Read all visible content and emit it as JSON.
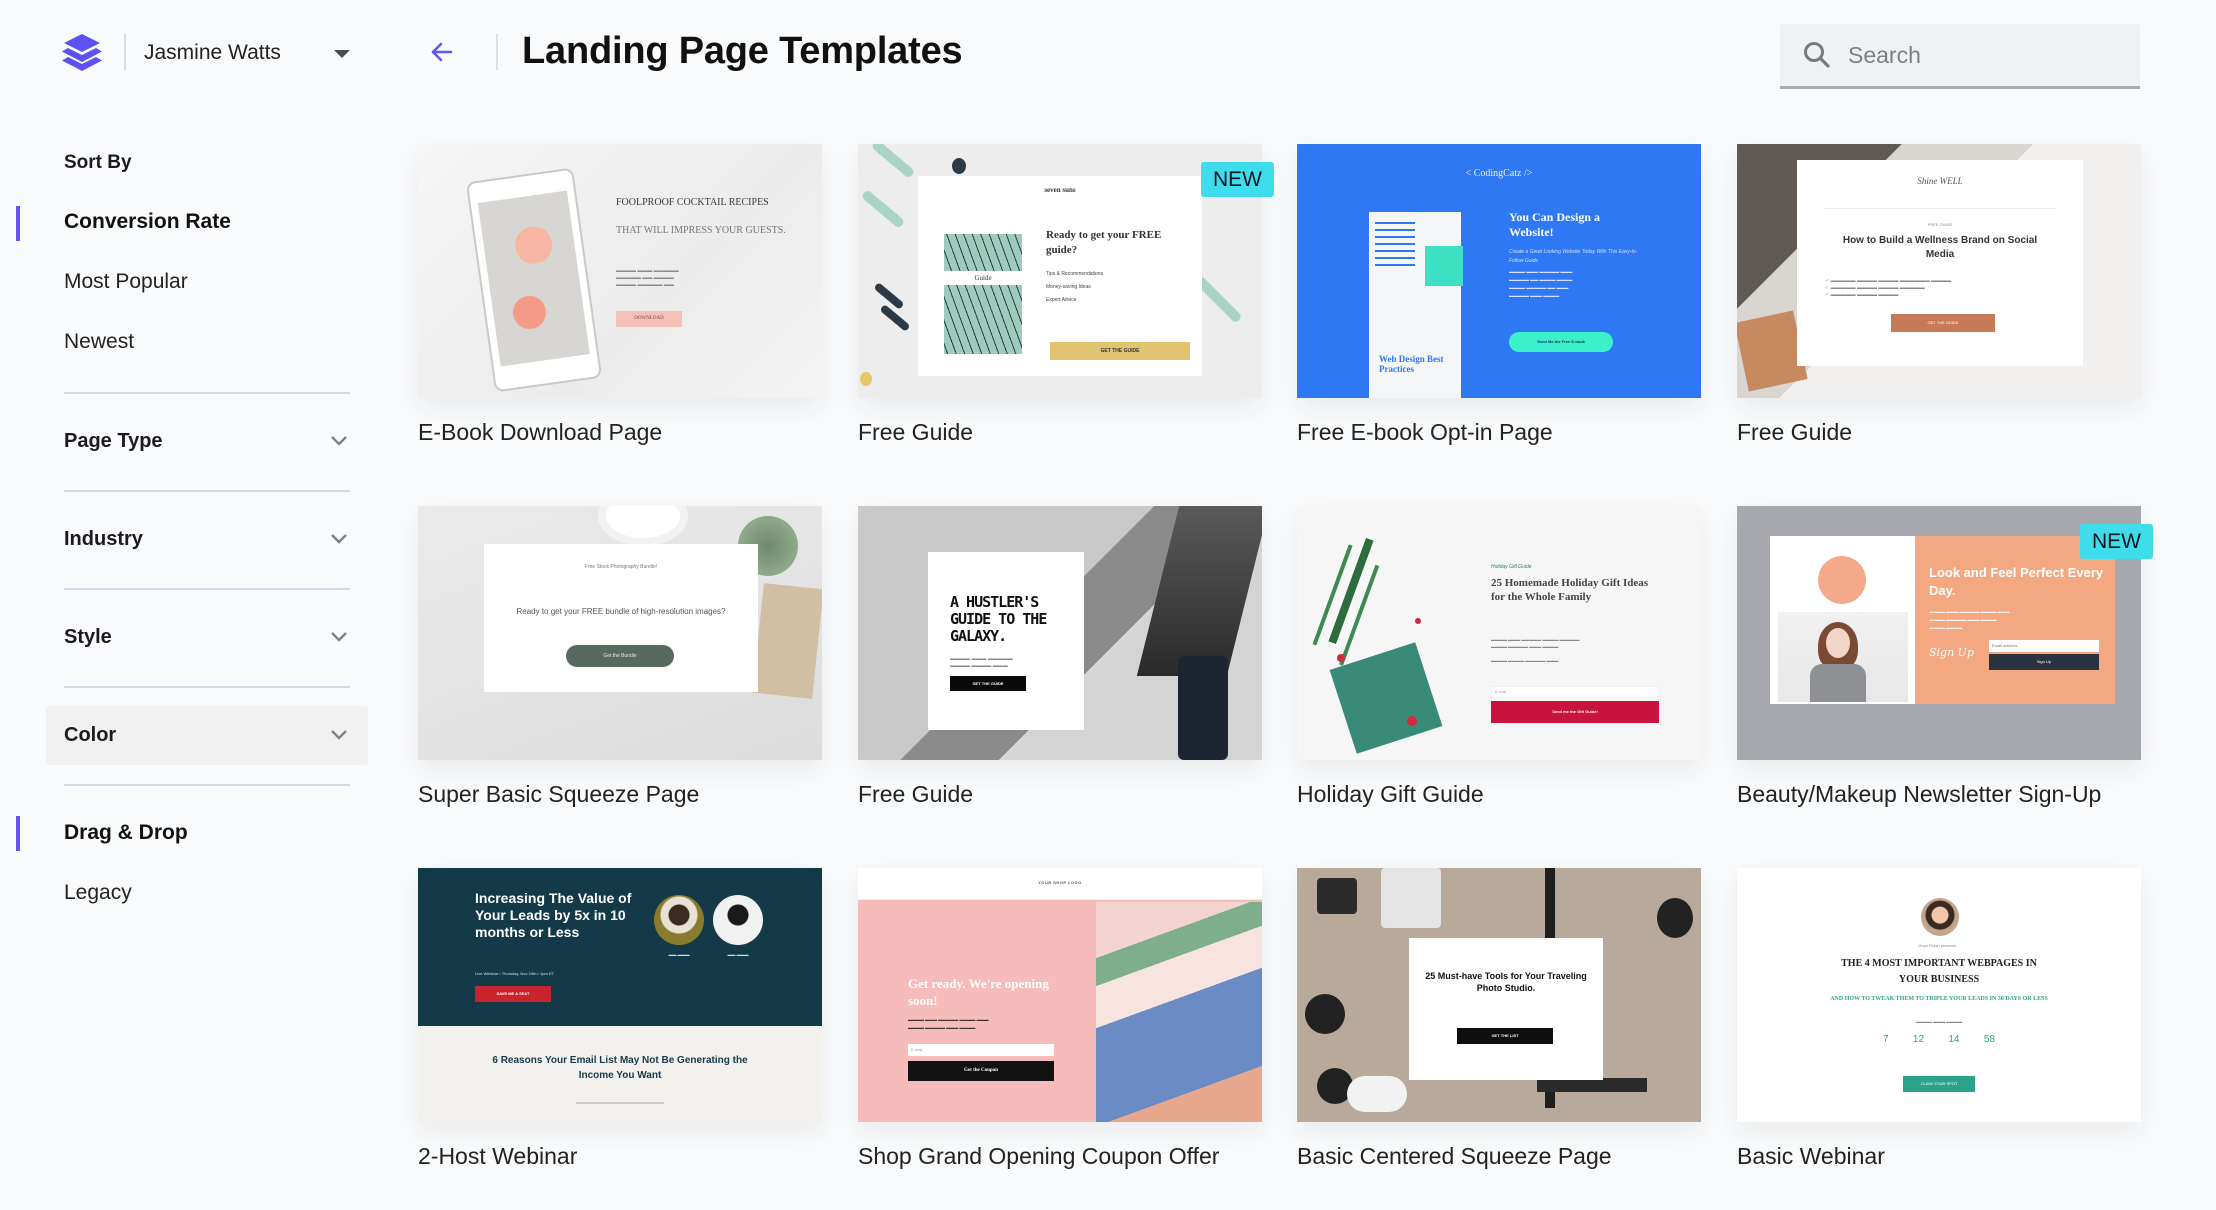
{
  "header": {
    "logo_icon": "layers-icon",
    "user_name": "Jasmine Watts",
    "user_menu_icon": "caret-down-icon",
    "back_icon": "arrow-left-icon",
    "title": "Landing Page Templates",
    "search": {
      "placeholder": "Search",
      "value": "",
      "icon": "search-icon"
    }
  },
  "sidebar": {
    "sort_label": "Sort By",
    "sort_options": [
      {
        "label": "Conversion Rate",
        "active": true
      },
      {
        "label": "Most Popular",
        "active": false
      },
      {
        "label": "Newest",
        "active": false
      }
    ],
    "filters": [
      {
        "label": "Page Type",
        "icon": "chevron-down-icon"
      },
      {
        "label": "Industry",
        "icon": "chevron-down-icon"
      },
      {
        "label": "Style",
        "icon": "chevron-down-icon"
      },
      {
        "label": "Color",
        "icon": "chevron-down-icon",
        "hovered": true
      }
    ],
    "builder_options": [
      {
        "label": "Drag & Drop",
        "active": true
      },
      {
        "label": "Legacy",
        "active": false
      }
    ]
  },
  "colors": {
    "accent": "#6654f5",
    "new_badge": "#3fdcec",
    "background": "#f9fafb"
  },
  "templates": [
    {
      "name": "E-Book Download Page",
      "is_new": false,
      "preview": {
        "heading": "FOOLPROOF COCKTAIL RECIPES",
        "subheading": "THAT WILL IMPRESS YOUR GUESTS.",
        "cta": "DOWNLOAD"
      }
    },
    {
      "name": "Free Guide",
      "is_new": true,
      "badge": "NEW",
      "preview": {
        "brand": "seven suns",
        "cover": "Guide",
        "heading": "Ready to get your FREE guide?",
        "bullets": [
          "Tips & Recommendations",
          "Money-saving Ideas",
          "Expert Advice"
        ],
        "cta": "GET THE GUIDE"
      }
    },
    {
      "name": "Free E-book Opt-in Page",
      "is_new": false,
      "preview": {
        "brand": "< CodingCatz />",
        "book": "Web Design Best Practices",
        "heading": "You Can Design a Website!",
        "subheading": "Create a Great Looking Website Today With This Easy-to-Follow Guide",
        "cta": "Send Me the Free E-book"
      }
    },
    {
      "name": "Free Guide",
      "is_new": false,
      "preview": {
        "brand": "Shine WELL",
        "kicker": "FREE GUIDE",
        "heading": "How to Build a Wellness Brand on Social Media",
        "cta": "GET THE GUIDE"
      }
    },
    {
      "name": "Super Basic Squeeze Page",
      "is_new": false,
      "preview": {
        "kicker": "Free Stock Photography Bundle!",
        "heading": "Ready to get your FREE bundle of high-resolution images?",
        "cta": "Get the Bundle"
      }
    },
    {
      "name": "Free Guide",
      "is_new": false,
      "preview": {
        "heading": "A HUSTLER'S GUIDE TO THE GALAXY.",
        "cta": "GET THE GUIDE"
      }
    },
    {
      "name": "Holiday Gift Guide",
      "is_new": false,
      "preview": {
        "kicker": "Holiday Gift Guide",
        "heading": "25 Homemade Holiday Gift Ideas for the Whole Family",
        "input": "E-mail",
        "cta": "Send me the Gift Guide!"
      }
    },
    {
      "name": "Beauty/Makeup Newsletter Sign-Up",
      "is_new": true,
      "badge": "NEW",
      "preview": {
        "heading": "Look and Feel Perfect Every Day.",
        "input": "Email address",
        "cta": "Sign Up"
      }
    },
    {
      "name": "2-Host Webinar",
      "is_new": false,
      "preview": {
        "heading": "Increasing The Value of Your Leads by 5x in 10 months or Less",
        "meta": "Live Webinar • Thursday, Nov 24th • 1pm ET",
        "cta": "SAVE ME A SEAT",
        "footer": "6 Reasons Your Email List May Not Be Generating the Income You Want"
      }
    },
    {
      "name": "Shop Grand Opening Coupon Offer",
      "is_new": false,
      "preview": {
        "brand": "YOUR SHOP LOGO",
        "heading": "Get ready. We're opening soon!",
        "input": "E-mail",
        "cta": "Get the Coupon"
      }
    },
    {
      "name": "Basic Centered Squeeze Page",
      "is_new": false,
      "preview": {
        "heading": "25 Must-have Tools for Your Traveling Photo Studio.",
        "cta": "GET THE LIST"
      }
    },
    {
      "name": "Basic Webinar",
      "is_new": false,
      "preview": {
        "kicker": "Hope Rubin presents...",
        "heading": "THE 4 MOST IMPORTANT WEBPAGES IN YOUR BUSINESS",
        "subheading": "AND HOW TO TWEAK THEM TO TRIPLE YOUR LEADS IN 30 DAYS OR LESS",
        "countdown": [
          "7",
          "12",
          "14",
          "58"
        ],
        "cta": "CLAIM YOUR SPOT"
      }
    }
  ]
}
